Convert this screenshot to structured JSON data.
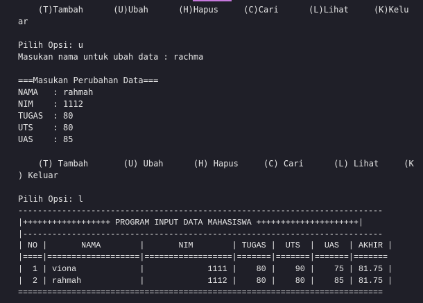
{
  "terminal": {
    "menu1": {
      "line1": "    (T)Tambah      (U)Ubah      (H)Hapus     (C)Cari      (L)Lihat     (K)Kelu",
      "line2": "ar"
    },
    "prompt1": "Pilih Opsi: u",
    "ask_name": "Masukan nama untuk ubah data : rachma",
    "section_header": "===Masukan Perubahan Data===",
    "fields": [
      "NAMA   : rahmah",
      "NIM    : 1112",
      "TUGAS  : 80",
      "UTS    : 80",
      "UAS    : 85"
    ],
    "menu2": {
      "line1": "    (T) Tambah       (U) Ubah      (H) Hapus     (C) Cari      (L) Lihat     (K",
      "line2": ") Keluar"
    },
    "prompt2": "Pilih Opsi: l",
    "table": {
      "top_border": "---------------------------------------------------------------------------",
      "title": "|++++++++++++++++++ PROGRAM INPUT DATA MAHASISWA +++++++++++++++++++++|",
      "title_under": "|--------------------------------------------------------------------------",
      "header": "| NO |       NAMA        |       NIM        | TUGAS |  UTS  |  UAS  | AKHIR |",
      "header_sep": "|====|===================|==================|=======|=======|=======|=======",
      "rows": [
        "|  1 | viona             |             1111 |    80 |    90 |    75 | 81.75 |",
        "|  2 | rahmah            |             1112 |    80 |    80 |    85 | 81.75 |"
      ],
      "bottom_border": "==========================================================================="
    }
  }
}
